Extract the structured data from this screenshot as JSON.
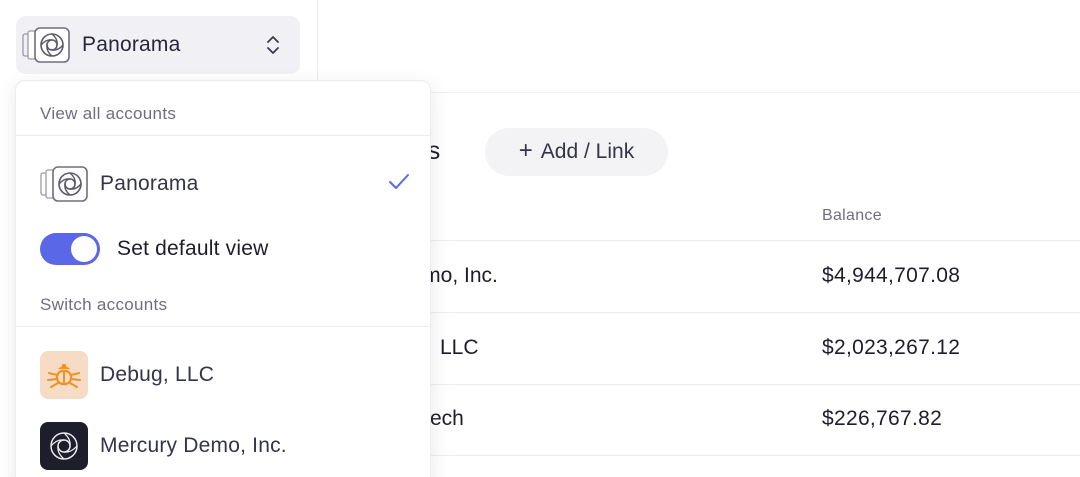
{
  "switcher": {
    "label": "Panorama"
  },
  "main": {
    "section_title_partial": "ons",
    "add_link_label": "Add / Link",
    "column_header_balance": "Balance",
    "rows": [
      {
        "name": "y Demo, Inc.",
        "balance": "$4,944,707.08"
      },
      {
        "name": "LLC",
        "balance": "$2,023,267.12"
      },
      {
        "name": "ech",
        "balance": "$226,767.82"
      }
    ]
  },
  "dropdown": {
    "view_all_heading": "View all accounts",
    "panorama_item": "Panorama",
    "default_view_label": "Set default view",
    "default_view_on": true,
    "switch_heading": "Switch accounts",
    "accounts": [
      {
        "name": "Debug, LLC",
        "icon": "bug-icon",
        "color": "#f59024"
      },
      {
        "name": "Mercury Demo, Inc.",
        "icon": "mercury-logo-icon",
        "color": "#1d1d2b"
      }
    ]
  },
  "colors": {
    "accent": "#5a67e6",
    "check": "#5a67e6"
  }
}
